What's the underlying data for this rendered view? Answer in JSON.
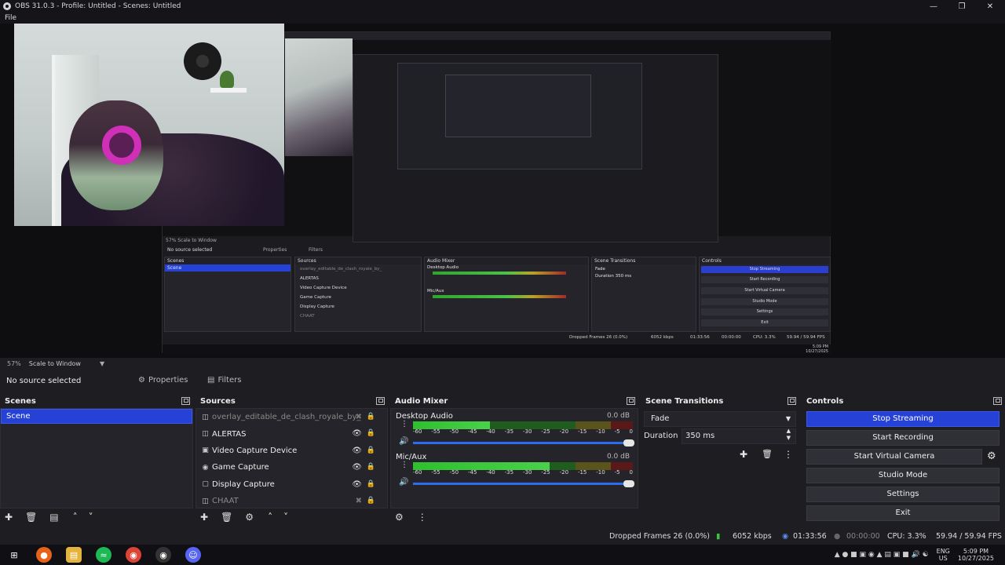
{
  "window": {
    "title": "OBS 31.0.3 - Profile: Untitled - Scenes: Untitled",
    "menu_first": "File"
  },
  "preview": {
    "nested": {
      "scale": "57%",
      "scale_mode": "Scale to Window",
      "no_source": "No source selected",
      "properties": "Properties",
      "filters": "Filters",
      "scenes_h": "Scenes",
      "scene": "Scene",
      "sources_h": "Sources",
      "mixer_h": "Audio Mixer",
      "transitions_h": "Scene Transitions",
      "controls_h": "Controls",
      "sources": [
        "overlay_editable_de_clash_royale_by_",
        "ALERTAS",
        "Video Capture Device",
        "Game Capture",
        "Display Capture",
        "CHAAT"
      ],
      "ch1": "Desktop Audio",
      "ch2": "Mic/Aux",
      "fade": "Fade",
      "duration": "Duration",
      "dur_val": "350 ms",
      "btns": [
        "Stop Streaming",
        "Start Recording",
        "Start Virtual Camera",
        "Studio Mode",
        "Settings",
        "Exit"
      ],
      "status": "Dropped Frames 26 (0.0%)",
      "kbps": "6052 kbps",
      "time1": "01:33:56",
      "time2": "00:00:00",
      "cpu": "CPU: 3.3%",
      "fps": "59.94 / 59.94 FPS",
      "tray_time": "5:09 PM",
      "tray_date": "10/27/2025"
    }
  },
  "zoom": {
    "level": "57%",
    "mode": "Scale to Window"
  },
  "sourcebar": {
    "no_source": "No source selected",
    "properties": "Properties",
    "filters": "Filters"
  },
  "scenes": {
    "title": "Scenes",
    "items": [
      "Scene"
    ]
  },
  "sources": {
    "title": "Sources",
    "items": [
      {
        "name": "overlay_editable_de_clash_royale_by_",
        "icon": "browser-icon",
        "visible": false
      },
      {
        "name": "ALERTAS",
        "icon": "browser-icon",
        "visible": true
      },
      {
        "name": "Video Capture Device",
        "icon": "camera-icon",
        "visible": true
      },
      {
        "name": "Game Capture",
        "icon": "gamepad-icon",
        "visible": true
      },
      {
        "name": "Display Capture",
        "icon": "monitor-icon",
        "visible": true
      },
      {
        "name": "CHAAT",
        "icon": "browser-icon",
        "visible": false
      }
    ]
  },
  "mixer": {
    "title": "Audio Mixer",
    "channels": [
      {
        "name": "Desktop Audio",
        "db": "0.0 dB",
        "level": 0.35
      },
      {
        "name": "Mic/Aux",
        "level_label": "Mic/Aux",
        "db": "0.0 dB",
        "level": 0.62
      }
    ],
    "scale": [
      "-60",
      "-55",
      "-50",
      "-45",
      "-40",
      "-35",
      "-30",
      "-25",
      "-20",
      "-15",
      "-10",
      "-5",
      "0"
    ]
  },
  "transitions": {
    "title": "Scene Transitions",
    "type": "Fade",
    "duration_label": "Duration",
    "duration": "350 ms"
  },
  "controls": {
    "title": "Controls",
    "buttons": [
      "Stop Streaming",
      "Start Recording",
      "Start Virtual Camera",
      "Studio Mode",
      "Settings",
      "Exit"
    ]
  },
  "status": {
    "dropped": "Dropped Frames 26 (0.0%)",
    "kbps": "6052 kbps",
    "stream_time": "01:33:56",
    "rec_time": "00:00:00",
    "cpu": "CPU: 3.3%",
    "fps": "59.94 / 59.94 FPS"
  },
  "taskbar": {
    "lang": "ENG",
    "region": "US",
    "time": "5:09 PM",
    "date": "10/27/2025"
  }
}
